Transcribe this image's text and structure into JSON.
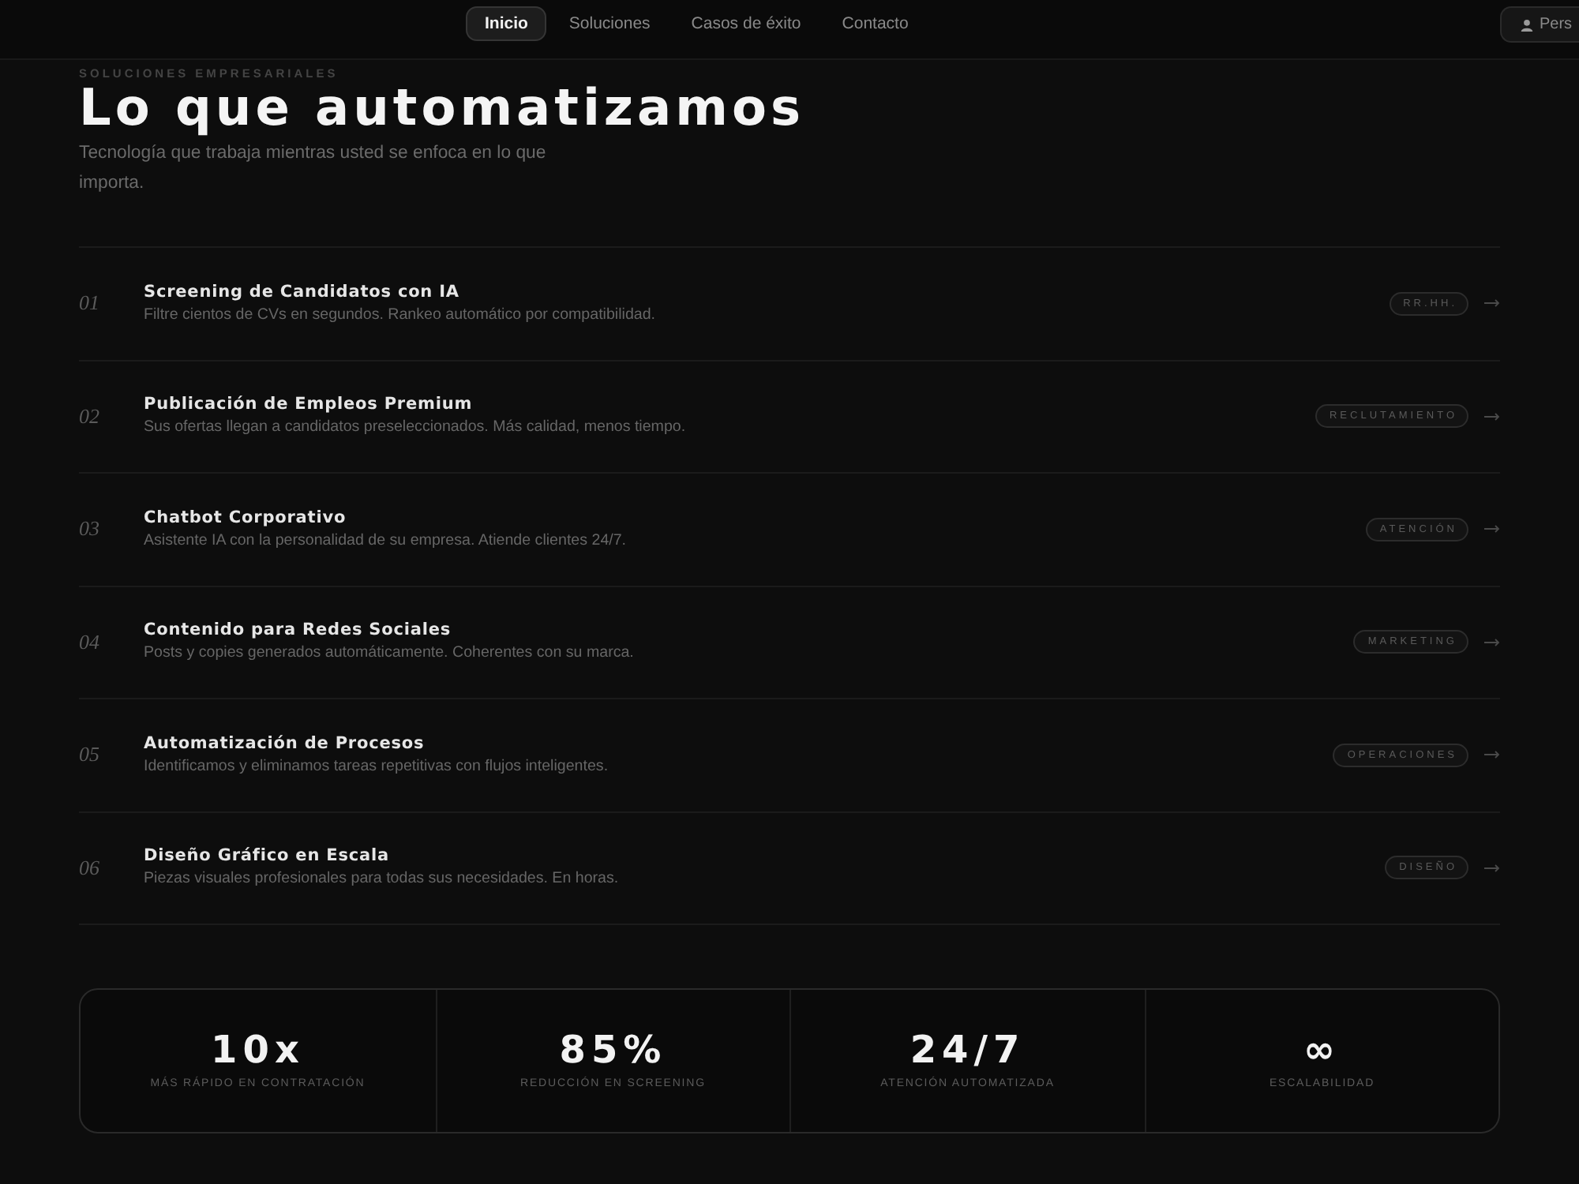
{
  "nav": {
    "links": [
      {
        "label": "Inicio",
        "selected": true
      },
      {
        "label": "Soluciones",
        "selected": false
      },
      {
        "label": "Casos de éxito",
        "selected": false
      },
      {
        "label": "Contacto",
        "selected": false
      }
    ],
    "account_button": {
      "label": "Pers"
    }
  },
  "section": {
    "eyebrow": "SOLUCIONES EMPRESARIALES",
    "title": "Lo que automatizamos",
    "subtitle": "Tecnología que trabaja mientras usted se enfoca en lo que importa."
  },
  "services": [
    {
      "number": "01",
      "title": "Screening de Candidatos con IA",
      "description": "Filtre cientos de CVs en segundos. Rankeo automático por compatibilidad.",
      "tag": "RR.HH."
    },
    {
      "number": "02",
      "title": "Publicación de Empleos Premium",
      "description": "Sus ofertas llegan a candidatos preseleccionados. Más calidad, menos tiempo.",
      "tag": "RECLUTAMIENTO"
    },
    {
      "number": "03",
      "title": "Chatbot Corporativo",
      "description": "Asistente IA con la personalidad de su empresa. Atiende clientes 24/7.",
      "tag": "ATENCIÓN"
    },
    {
      "number": "04",
      "title": "Contenido para Redes Sociales",
      "description": "Posts y copies generados automáticamente. Coherentes con su marca.",
      "tag": "MARKETING"
    },
    {
      "number": "05",
      "title": "Automatización de Procesos",
      "description": "Identificamos y eliminamos tareas repetitivas con flujos inteligentes.",
      "tag": "OPERACIONES"
    },
    {
      "number": "06",
      "title": "Diseño Gráfico en Escala",
      "description": "Piezas visuales profesionales para todas sus necesidades. En horas.",
      "tag": "DISEÑO"
    }
  ],
  "stats": [
    {
      "value": "10x",
      "label": "MÁS RÁPIDO EN CONTRATACIÓN"
    },
    {
      "value": "85%",
      "label": "REDUCCIÓN EN SCREENING"
    },
    {
      "value": "24/7",
      "label": "ATENCIÓN AUTOMATIZADA"
    },
    {
      "value": "∞",
      "label": "ESCALABILIDAD"
    }
  ]
}
